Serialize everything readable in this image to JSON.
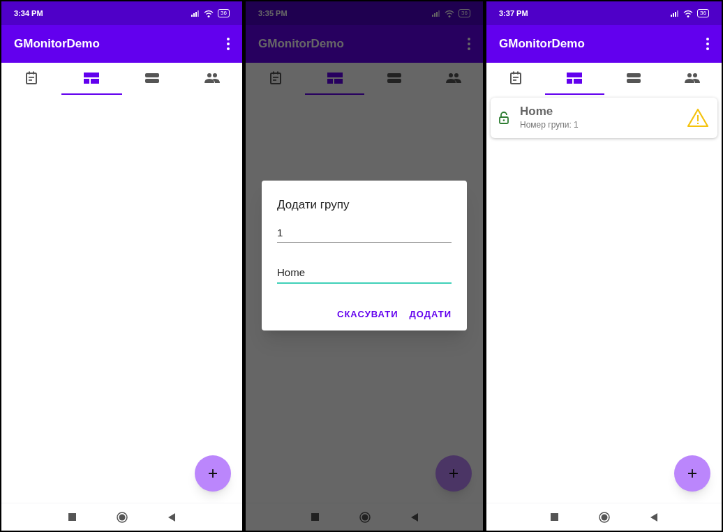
{
  "screens": [
    {
      "status_time": "3:34 PM",
      "battery": "36",
      "app_title": "GMonitorDemo",
      "dimmed": false,
      "tabs": [
        {
          "selected": false
        },
        {
          "selected": true
        },
        {
          "selected": false
        },
        {
          "selected": false
        }
      ]
    },
    {
      "status_time": "3:35 PM",
      "battery": "36",
      "app_title": "GMonitorDemo",
      "dimmed": true,
      "tabs": [
        {
          "selected": false
        },
        {
          "selected": true
        },
        {
          "selected": false
        },
        {
          "selected": false
        }
      ],
      "dialog": {
        "title": "Додати групу",
        "fields": [
          {
            "value": "1",
            "focused": false
          },
          {
            "value": "Home",
            "focused": true
          }
        ],
        "buttons": [
          "СКАСУВАТИ",
          "ДОДАТИ"
        ]
      }
    },
    {
      "status_time": "3:37 PM",
      "battery": "36",
      "app_title": "GMonitorDemo",
      "dimmed": false,
      "tabs": [
        {
          "selected": false
        },
        {
          "selected": true
        },
        {
          "selected": false
        },
        {
          "selected": false
        }
      ],
      "groups": [
        {
          "name": "Home",
          "subtitle": "Номер групи: 1",
          "locked": false,
          "warning": true
        }
      ]
    }
  ]
}
